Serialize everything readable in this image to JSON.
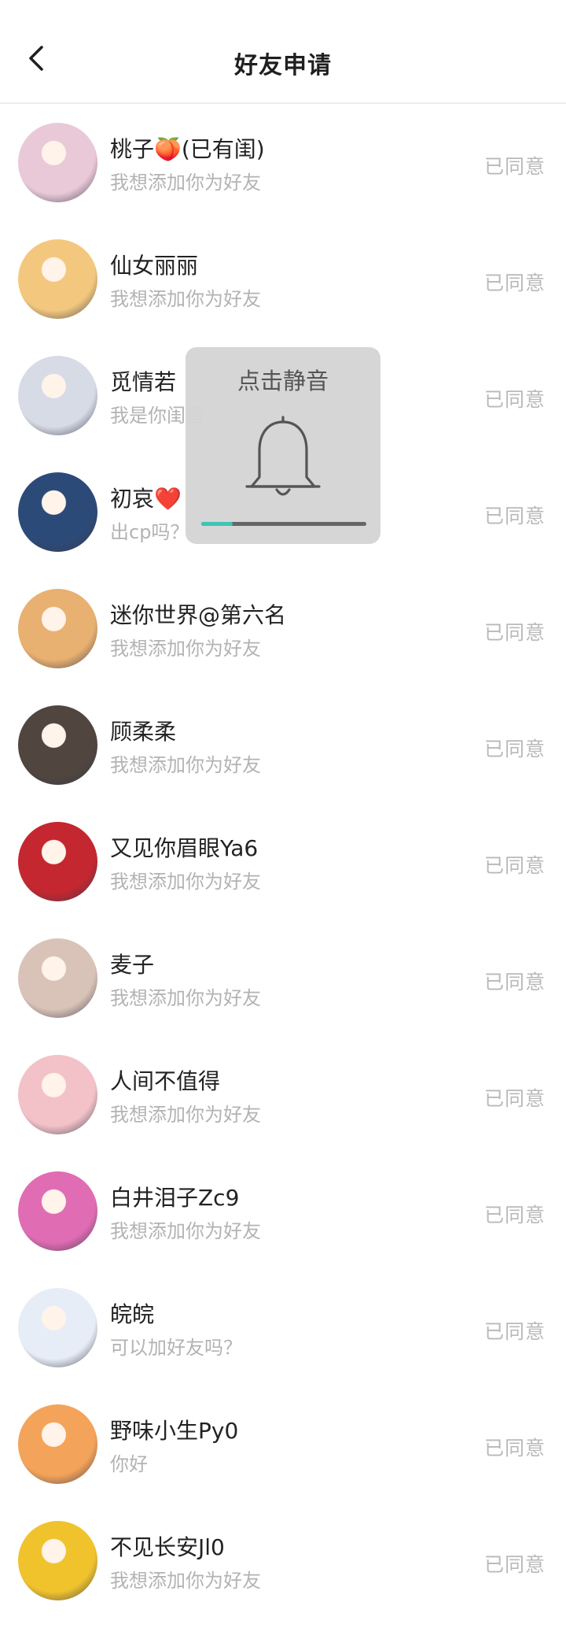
{
  "header": {
    "title": "好友申请"
  },
  "requests": [
    {
      "name": "桃子🍑(已有闺)",
      "message": "我想添加你为好友",
      "status": "已同意"
    },
    {
      "name": "仙女丽丽",
      "message": "我想添加你为好友",
      "status": "已同意"
    },
    {
      "name": "觅情若",
      "message": "我是你闺蜜",
      "status": "已同意"
    },
    {
      "name": "初哀❤️",
      "message": "出cp吗？",
      "status": "已同意"
    },
    {
      "name": "迷你世界@第六名",
      "message": "我想添加你为好友",
      "status": "已同意"
    },
    {
      "name": "顾柔柔",
      "message": "我想添加你为好友",
      "status": "已同意"
    },
    {
      "name": "又见你眉眼Ya6",
      "message": "我想添加你为好友",
      "status": "已同意"
    },
    {
      "name": "麦子",
      "message": "我想添加你为好友",
      "status": "已同意"
    },
    {
      "name": "人间不值得",
      "message": "我想添加你为好友",
      "status": "已同意"
    },
    {
      "name": "白井泪子Zc9",
      "message": "我想添加你为好友",
      "status": "已同意"
    },
    {
      "name": "皖皖",
      "message": "可以加好友吗？",
      "status": "已同意"
    },
    {
      "name": "野味小生Py0",
      "message": "你好",
      "status": "已同意"
    },
    {
      "name": "不见长安Jl0",
      "message": "我想添加你为好友",
      "status": "已同意"
    }
  ],
  "mute_toast": {
    "label": "点击静音",
    "volume_level": 0.19
  },
  "colors": {
    "accent": "#3ec5b5",
    "status_text": "#b9b9b9",
    "avatar_palette": [
      "#e9c9d8",
      "#f3c87e",
      "#d7dbe6",
      "#2c4a78",
      "#e8b071",
      "#50453f",
      "#c4272f",
      "#d9c3b8",
      "#f2c2c8",
      "#e06db3",
      "#e7edf7",
      "#f4a35a",
      "#f0c32d"
    ]
  },
  "icons": {
    "back": "chevron-left-icon",
    "bell": "bell-icon"
  }
}
